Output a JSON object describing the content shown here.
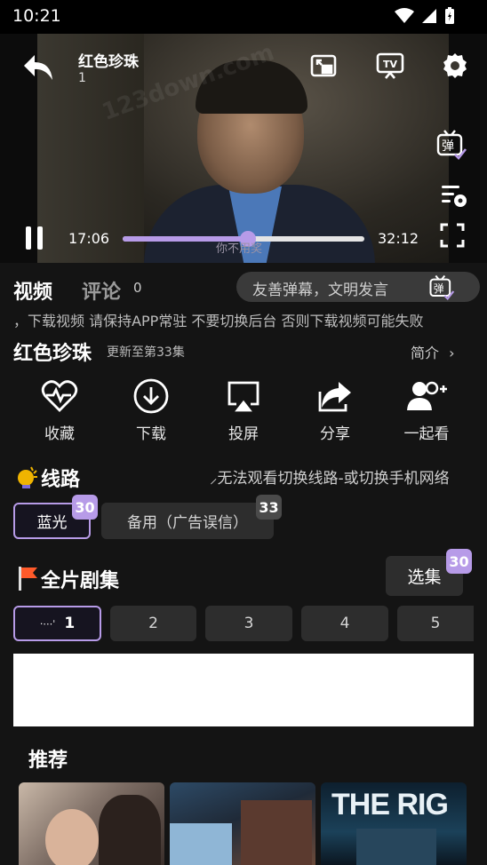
{
  "status_bar": {
    "time": "10:21"
  },
  "player": {
    "title": "红色珍珠",
    "episode": "1",
    "subtitle": "你不用奖",
    "time_current": "17:06",
    "time_total": "32:12",
    "progress": 0.52,
    "icons": [
      "back-icon",
      "pip-icon",
      "tv-cast-icon",
      "settings-icon",
      "danmaku-icon",
      "danmaku-settings-icon",
      "pause-icon",
      "fullscreen-icon"
    ]
  },
  "tabs": {
    "video": "视频",
    "comments": "评论",
    "comment_count": "0"
  },
  "danmaku_input": {
    "placeholder": "友善弹幕，文明发言"
  },
  "marquee": "，下载视频 请保持APP常驻 不要切换后台 否则下载视频可能失败",
  "show": {
    "title": "红色珍珠",
    "update": "更新至第33集",
    "intro": "简介"
  },
  "actions": [
    {
      "label": "收藏",
      "icon": "heart-pulse-icon"
    },
    {
      "label": "下载",
      "icon": "download-icon"
    },
    {
      "label": "投屏",
      "icon": "cast-icon"
    },
    {
      "label": "分享",
      "icon": "share-icon"
    },
    {
      "label": "一起看",
      "icon": "watch-together-icon"
    }
  ],
  "routes": {
    "title": "线路",
    "tip": "⸝无法观看切换线路-或切换手机网络",
    "items": [
      {
        "label": "蓝光",
        "badge": "30",
        "selected": true
      },
      {
        "label": "备用（广告误信）",
        "badge": "33",
        "selected": false
      }
    ]
  },
  "episodes": {
    "title": "全片剧集",
    "select_label": "选集",
    "select_badge": "30",
    "items": [
      "1",
      "2",
      "3",
      "4",
      "5"
    ]
  },
  "recommend": {
    "title": "推荐",
    "posters": [
      {
        "text": ""
      },
      {
        "text": ""
      },
      {
        "text": "THE RIG"
      }
    ]
  },
  "colors": {
    "accent": "#b79be8",
    "background": "#141414",
    "chip": "#2d2d2d"
  }
}
